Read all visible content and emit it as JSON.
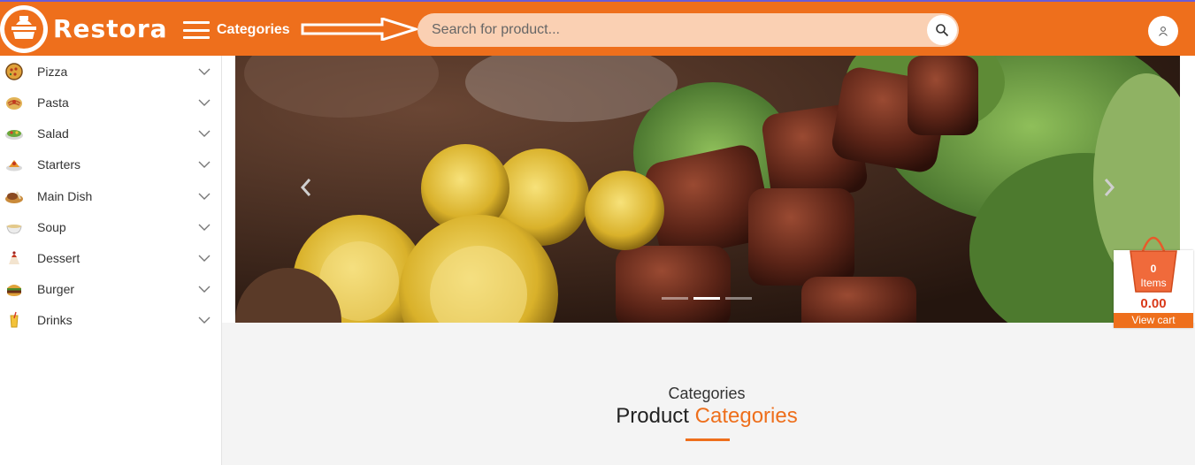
{
  "brand": {
    "name": "Restora",
    "accent": "#ee6f1c"
  },
  "header": {
    "categories_label": "Categories",
    "search_placeholder": "Search for product..."
  },
  "sidebar": {
    "items": [
      {
        "label": "Pizza",
        "icon": "pizza-icon"
      },
      {
        "label": "Pasta",
        "icon": "pasta-icon"
      },
      {
        "label": "Salad",
        "icon": "salad-icon"
      },
      {
        "label": "Starters",
        "icon": "starters-icon"
      },
      {
        "label": "Main Dish",
        "icon": "main-dish-icon"
      },
      {
        "label": "Soup",
        "icon": "soup-icon"
      },
      {
        "label": "Dessert",
        "icon": "dessert-icon"
      },
      {
        "label": "Burger",
        "icon": "burger-icon"
      },
      {
        "label": "Drinks",
        "icon": "drinks-icon"
      }
    ]
  },
  "hero": {
    "slide_count": 3,
    "active_slide": 2
  },
  "cart": {
    "count": "0",
    "items_label": "Items",
    "total": "0.00",
    "view_label": "View cart"
  },
  "section": {
    "kicker": "Categories",
    "title_plain": "Product",
    "title_accent": "Categories"
  }
}
